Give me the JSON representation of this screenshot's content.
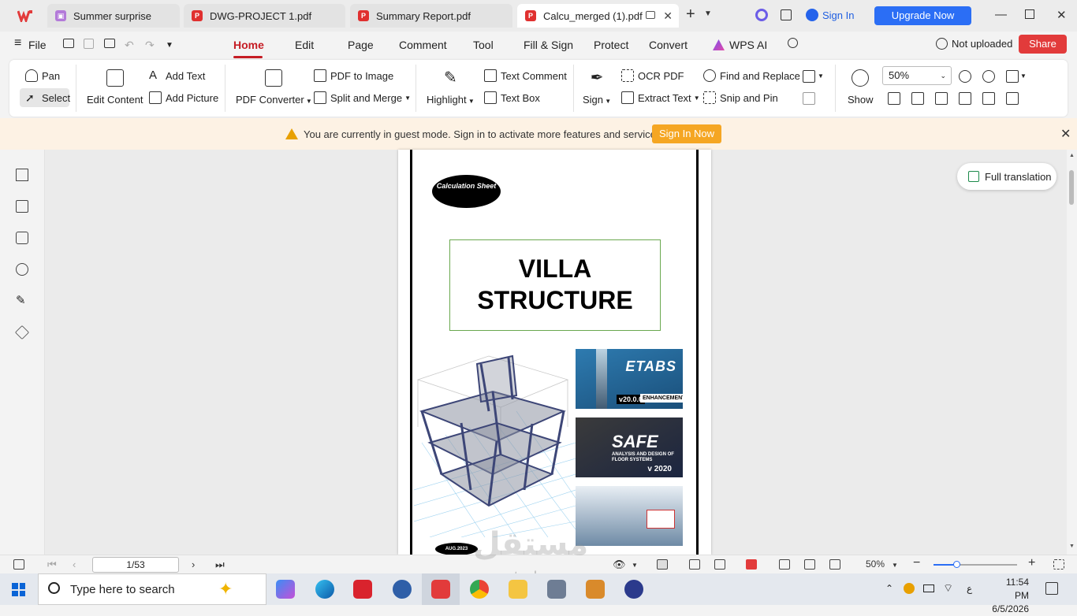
{
  "tabs": [
    {
      "label": "Summer surprise",
      "icon": "gift-icon"
    },
    {
      "label": "DWG-PROJECT 1.pdf",
      "icon": "pdf-icon"
    },
    {
      "label": "Summary Report.pdf",
      "icon": "pdf-icon"
    },
    {
      "label": "Calcu_merged (1).pdf",
      "icon": "pdf-icon",
      "active": true
    }
  ],
  "header": {
    "sign_in": "Sign In",
    "upgrade": "Upgrade Now"
  },
  "menu": {
    "file": "File",
    "items": [
      "Home",
      "Edit",
      "Page",
      "Comment",
      "Tool",
      "Fill & Sign",
      "Protect",
      "Convert",
      "WPS AI"
    ],
    "not_uploaded": "Not uploaded",
    "share": "Share"
  },
  "ribbon": {
    "pan": "Pan",
    "select": "Select",
    "edit_content": "Edit Content",
    "add_text": "Add Text",
    "add_picture": "Add Picture",
    "pdf_converter": "PDF Converter",
    "pdf_to_image": "PDF to Image",
    "split_merge": "Split and Merge",
    "highlight": "Highlight",
    "text_comment": "Text Comment",
    "text_box": "Text Box",
    "sign": "Sign",
    "ocr_pdf": "OCR PDF",
    "extract_text": "Extract Text",
    "find_replace": "Find and Replace",
    "snip_pin": "Snip and Pin",
    "show": "Show",
    "zoom": "50%"
  },
  "banner": {
    "message": "You are currently in guest mode. Sign in to activate more features and services.",
    "button": "Sign In Now"
  },
  "document": {
    "badge": "Calculation Sheet",
    "title_line1": "VILLA",
    "title_line2": "STRUCTURE",
    "etabs_brand": "ETABS",
    "etabs_version": "v20.0.0",
    "etabs_sub": "ENHANCEMENTS",
    "safe_brand": "SAFE",
    "safe_sub": "ANALYSIS AND DESIGN OF FLOOR SYSTEMS",
    "safe_version": "v 2020",
    "date_badge": "AUG.2023"
  },
  "full_translation": "Full translation",
  "status": {
    "page": "1/53",
    "zoom": "50%",
    "zoom_fraction": 0.28
  },
  "taskbar": {
    "search_placeholder": "Type here to search",
    "time": "11:54 PM",
    "date": "6/5/2026",
    "lang": "ع"
  },
  "watermark": {
    "text_ar": "مستقل",
    "text_en": "mostaql.com"
  },
  "colors": {
    "accent": "#c51c24",
    "upgrade": "#2b6ef5",
    "share": "#e23b3b",
    "signnow": "#f5a623"
  }
}
